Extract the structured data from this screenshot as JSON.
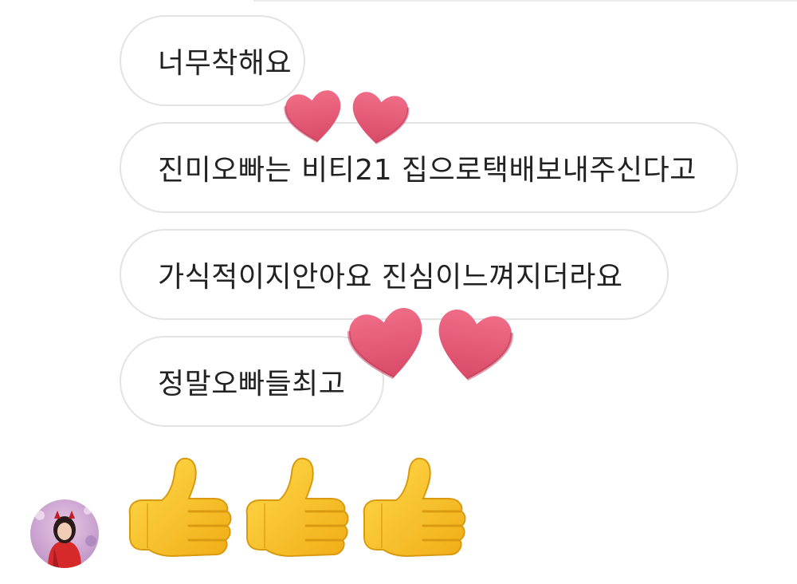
{
  "messages": [
    {
      "text": "너무착해요"
    },
    {
      "text": "진미오빠는 비티21 집으로택배보내주신다고"
    },
    {
      "text": "가식적이지안아요 진심이느껴지더라요"
    },
    {
      "text": "정말오빠들최고"
    }
  ],
  "stickers": {
    "hearts": "two-hearts-icon",
    "thumbs": "thumbs-up-icon"
  },
  "colors": {
    "bubble_border": "#e3e3e3",
    "text": "#222222",
    "heart": "#e55a78",
    "thumb": "#f7c327",
    "avatar_bg": "#c9a6cf",
    "avatar_red": "#d62a2a"
  }
}
